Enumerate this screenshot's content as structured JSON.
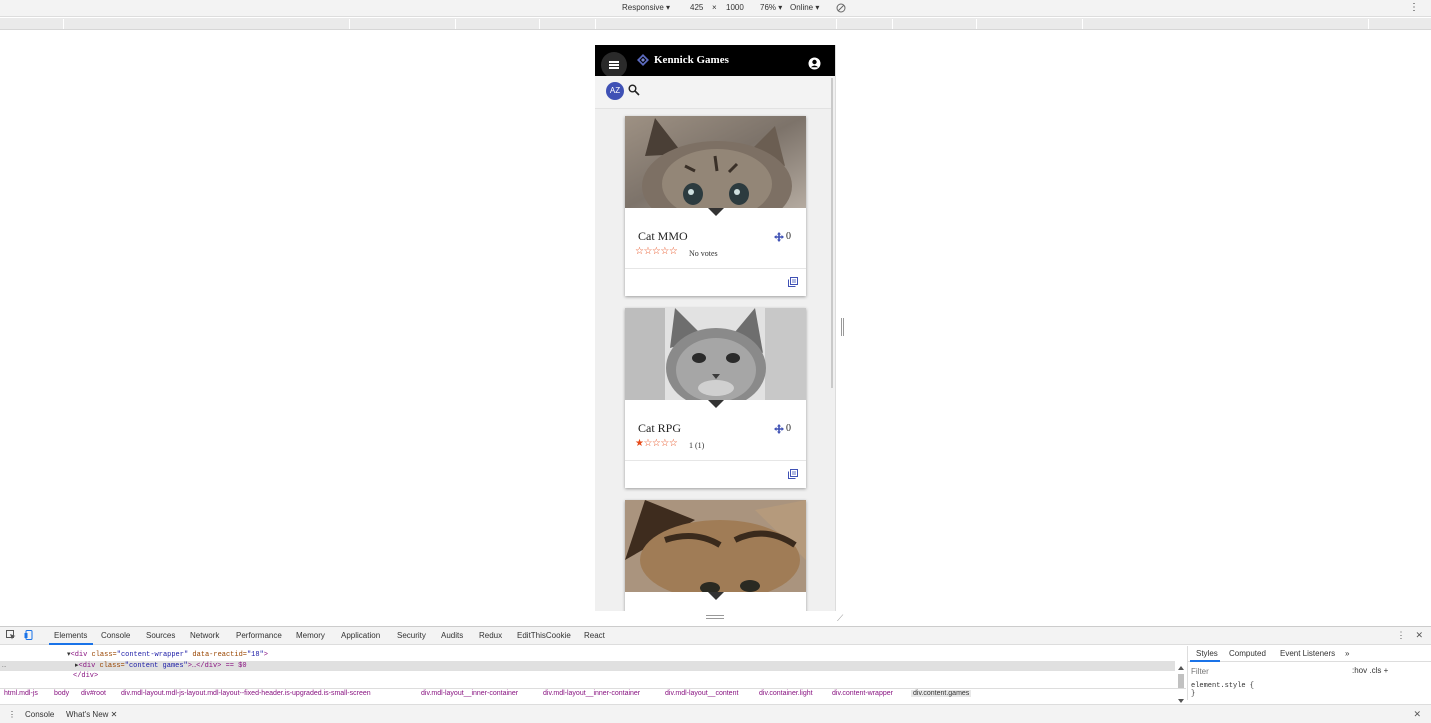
{
  "device_toolbar": {
    "mode": "Responsive ▾",
    "width": "425",
    "times": "×",
    "height": "1000",
    "zoom": "76% ▾",
    "throttle": "Online ▾",
    "more": "⋮"
  },
  "app": {
    "title": "Kennick Games",
    "sort_button": "AZ",
    "accent_color": "#3f51b5",
    "header_color": "#000000",
    "star_color": "#e64a19"
  },
  "games": [
    {
      "title": "Cat MMO",
      "players": "0",
      "stars": "☆☆☆☆☆",
      "votes": "No votes"
    },
    {
      "title": "Cat RPG",
      "players": "0",
      "stars": "★☆☆☆☆",
      "votes": "1 (1)"
    },
    {
      "title": "",
      "players": "",
      "stars": "",
      "votes": ""
    }
  ],
  "devtools": {
    "tabs": [
      "Elements",
      "Console",
      "Sources",
      "Network",
      "Performance",
      "Memory",
      "Application",
      "Security",
      "Audits",
      "Redux",
      "EditThisCookie",
      "React"
    ],
    "code": {
      "line1_tag_open": "<div ",
      "line1_attr1": "class=",
      "line1_val1": "\"content-wrapper\"",
      "line1_attr2": " data-reactid=",
      "line1_val2": "\"18\"",
      "line1_tag_close": ">",
      "line2_tag_open": "<div ",
      "line2_attr": "class=",
      "line2_val": "\"content games\"",
      "line2_rest": ">…</div> == $0",
      "line3": "</div>"
    },
    "breadcrumbs": [
      "html.mdl-js",
      "body",
      "div#root",
      "div.mdl-layout.mdl-js-layout.mdl-layout--fixed-header.is-upgraded.is-small-screen",
      "div.mdl-layout__inner-container",
      "div.mdl-layout__inner-container",
      "div.mdl-layout__content",
      "div.container.light",
      "div.content-wrapper",
      "div.content.games"
    ],
    "styles_tabs": [
      "Styles",
      "Computed",
      "Event Listeners",
      "»"
    ],
    "filter_placeholder": "Filter",
    "style_tools": ":hov  .cls  +",
    "element_style": "element.style {",
    "element_style_close": "}",
    "drawer_tabs": [
      "Console",
      "What's New ✕"
    ],
    "close": "✕"
  }
}
